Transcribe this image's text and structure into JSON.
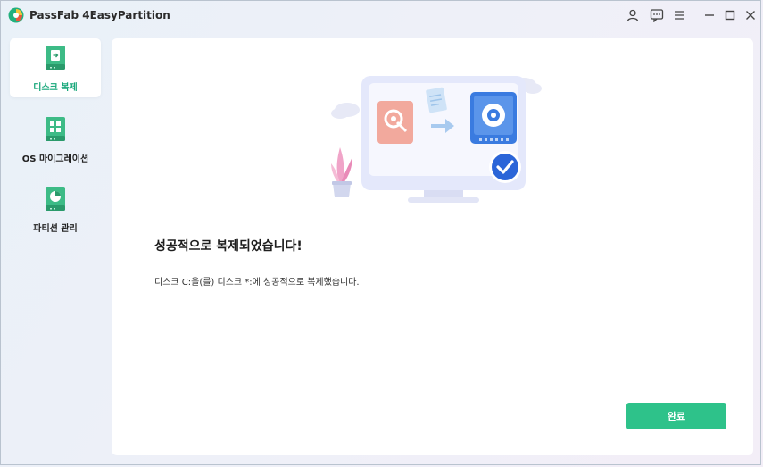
{
  "app": {
    "title": "PassFab 4EasyPartition"
  },
  "titlebar": {
    "icons": [
      "user-icon",
      "feedback-icon",
      "menu-icon",
      "minimize-icon",
      "maximize-icon",
      "close-icon"
    ]
  },
  "sidebar": {
    "items": [
      {
        "label": "디스크 복제",
        "icon": "disk-clone-icon",
        "active": true
      },
      {
        "label": "OS 마이그레이션",
        "icon": "os-migration-icon",
        "active": false
      },
      {
        "label": "파티션 관리",
        "icon": "partition-manage-icon",
        "active": false
      }
    ]
  },
  "main": {
    "headline": "성공적으로 복제되었습니다!",
    "message": "디스크 C:을(를) 디스크 *:에 성공적으로 복제했습니다.",
    "done_label": "완료"
  },
  "colors": {
    "accent": "#2ec28a",
    "active_label": "#18a77a",
    "source_disk": "#f2a99d",
    "target_disk": "#3a7be0"
  }
}
